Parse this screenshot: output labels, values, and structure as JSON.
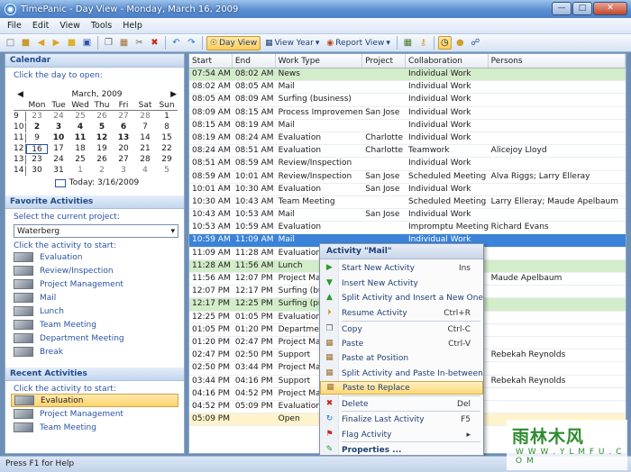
{
  "window": {
    "title": "TimePanic - Day View - Monday, March 16, 2009"
  },
  "menu": [
    "File",
    "Edit",
    "View",
    "Tools",
    "Help"
  ],
  "toolbar": {
    "day_view": "Day View",
    "view_year": "View Year",
    "report_view": "Report View"
  },
  "calendar": {
    "header": "Calendar",
    "hint": "Click the day to open:",
    "month": "March, 2009",
    "weekdays": [
      "Mon",
      "Tue",
      "Wed",
      "Thu",
      "Fri",
      "Sat",
      "Sun"
    ],
    "weeks": [
      {
        "wk": "9",
        "days": [
          "23",
          "24",
          "25",
          "26",
          "27",
          "28",
          "1"
        ]
      },
      {
        "wk": "10",
        "days": [
          "2",
          "3",
          "4",
          "5",
          "6",
          "7",
          "8"
        ]
      },
      {
        "wk": "11",
        "days": [
          "9",
          "10",
          "11",
          "12",
          "13",
          "14",
          "15"
        ]
      },
      {
        "wk": "12",
        "days": [
          "16",
          "17",
          "18",
          "19",
          "20",
          "21",
          "22"
        ]
      },
      {
        "wk": "13",
        "days": [
          "23",
          "24",
          "25",
          "26",
          "27",
          "28",
          "29"
        ]
      },
      {
        "wk": "14",
        "days": [
          "30",
          "31",
          "1",
          "2",
          "3",
          "4",
          "5"
        ]
      }
    ],
    "today_label": "Today: 3/16/2009"
  },
  "favorites": {
    "header": "Favorite Activities",
    "project_hint": "Select the current project:",
    "project": "Waterberg",
    "activity_hint": "Click the activity to start:",
    "items": [
      "Evaluation",
      "Review/Inspection",
      "Project Management",
      "Mail",
      "Lunch",
      "Team Meeting",
      "Department Meeting",
      "Break"
    ]
  },
  "recent": {
    "header": "Recent Activities",
    "hint": "Click the activity to start:",
    "items": [
      "Evaluation",
      "Project Management",
      "Team Meeting"
    ]
  },
  "table": {
    "columns": [
      "Start",
      "End",
      "Work Type",
      "Project",
      "Collaboration",
      "Persons"
    ],
    "rows": [
      [
        "07:54 AM",
        "08:02 AM",
        "News",
        "",
        "Individual Work",
        ""
      ],
      [
        "08:02 AM",
        "08:05 AM",
        "Mail",
        "",
        "Individual Work",
        ""
      ],
      [
        "08:05 AM",
        "08:09 AM",
        "Surfing (business)",
        "",
        "Individual Work",
        ""
      ],
      [
        "08:09 AM",
        "08:15 AM",
        "Process Improvement",
        "San Jose",
        "Individual Work",
        ""
      ],
      [
        "08:15 AM",
        "08:19 AM",
        "Mail",
        "",
        "Individual Work",
        ""
      ],
      [
        "08:19 AM",
        "08:24 AM",
        "Evaluation",
        "Charlotte",
        "Individual Work",
        ""
      ],
      [
        "08:24 AM",
        "08:51 AM",
        "Evaluation",
        "Charlotte",
        "Teamwork",
        "Alicejoy Lloyd"
      ],
      [
        "08:51 AM",
        "08:59 AM",
        "Review/Inspection",
        "",
        "Individual Work",
        ""
      ],
      [
        "08:59 AM",
        "10:01 AM",
        "Review/Inspection",
        "San Jose",
        "Scheduled Meeting",
        "Alva Riggs; Larry Elleray"
      ],
      [
        "10:01 AM",
        "10:30 AM",
        "Evaluation",
        "San Jose",
        "Individual Work",
        ""
      ],
      [
        "10:30 AM",
        "10:43 AM",
        "Team Meeting",
        "",
        "Scheduled Meeting",
        "Larry Elleray; Maude Apelbaum"
      ],
      [
        "10:43 AM",
        "10:53 AM",
        "Mail",
        "San Jose",
        "Individual Work",
        ""
      ],
      [
        "10:53 AM",
        "10:59 AM",
        "Evaluation",
        "",
        "Impromptu Meeting",
        "Richard Evans"
      ],
      [
        "10:59 AM",
        "11:09 AM",
        "Mail",
        "",
        "Individual Work",
        ""
      ],
      [
        "11:09 AM",
        "11:28 AM",
        "Evaluation",
        "",
        "",
        ""
      ],
      [
        "11:28 AM",
        "11:56 AM",
        "Lunch",
        "",
        "",
        ""
      ],
      [
        "11:56 AM",
        "12:07 PM",
        "Project Mar",
        "",
        "",
        "Maude Apelbaum"
      ],
      [
        "12:07 PM",
        "12:17 PM",
        "Surfing (bu",
        "",
        "",
        ""
      ],
      [
        "12:17 PM",
        "12:25 PM",
        "Surfing (priv",
        "",
        "",
        ""
      ],
      [
        "12:25 PM",
        "01:05 PM",
        "Evaluation",
        "",
        "",
        ""
      ],
      [
        "01:05 PM",
        "01:20 PM",
        "Departmen",
        "",
        "",
        ""
      ],
      [
        "01:20 PM",
        "02:47 PM",
        "Project Mar",
        "",
        "",
        ""
      ],
      [
        "02:47 PM",
        "02:50 PM",
        "Support",
        "",
        "",
        "Rebekah Reynolds"
      ],
      [
        "02:50 PM",
        "03:44 PM",
        "Project Mar",
        "",
        "",
        ""
      ],
      [
        "03:44 PM",
        "04:16 PM",
        "Support",
        "",
        "",
        "Rebekah Reynolds"
      ],
      [
        "04:16 PM",
        "04:52 PM",
        "Project Mar",
        "",
        "",
        ""
      ],
      [
        "04:52 PM",
        "05:09 PM",
        "Evaluation",
        "",
        "",
        ""
      ],
      [
        "05:09 PM",
        "",
        "Open",
        "",
        "",
        ""
      ]
    ],
    "row_styles": [
      "green",
      "",
      "",
      "",
      "",
      "",
      "",
      "",
      "",
      "",
      "",
      "",
      "",
      "sel",
      "",
      "green",
      "",
      "",
      "green",
      "",
      "",
      "",
      "",
      "",
      "",
      "",
      "",
      "yellow"
    ]
  },
  "context_menu": {
    "title": "Activity \"Mail\"",
    "items": [
      {
        "label": "Start New Activity",
        "key": "Ins"
      },
      {
        "label": "Insert New Activity",
        "key": ""
      },
      {
        "label": "Split Activity and Insert a New One",
        "key": ""
      },
      {
        "label": "Resume Activity",
        "key": "Ctrl+R"
      },
      {
        "label": "Copy",
        "key": "Ctrl-C"
      },
      {
        "label": "Paste",
        "key": "Ctrl-V"
      },
      {
        "label": "Paste at Position",
        "key": ""
      },
      {
        "label": "Split Activity and Paste In-between",
        "key": ""
      },
      {
        "label": "Paste to Replace",
        "key": ""
      },
      {
        "label": "Delete",
        "key": "Del"
      },
      {
        "label": "Finalize Last Activity",
        "key": "F5"
      },
      {
        "label": "Flag Activity",
        "key": ""
      },
      {
        "label": "Properties ...",
        "key": ""
      }
    ]
  },
  "status": {
    "text": "Press F1 for Help"
  },
  "watermark": {
    "line1": "雨林木风",
    "line2": "W W W . Y L M F U . C O M"
  },
  "colors": {
    "selected_row": "#3a83d9",
    "green_row": "#d3ecc9",
    "open_row": "#fff3cc",
    "accent": "#ffd46e"
  }
}
